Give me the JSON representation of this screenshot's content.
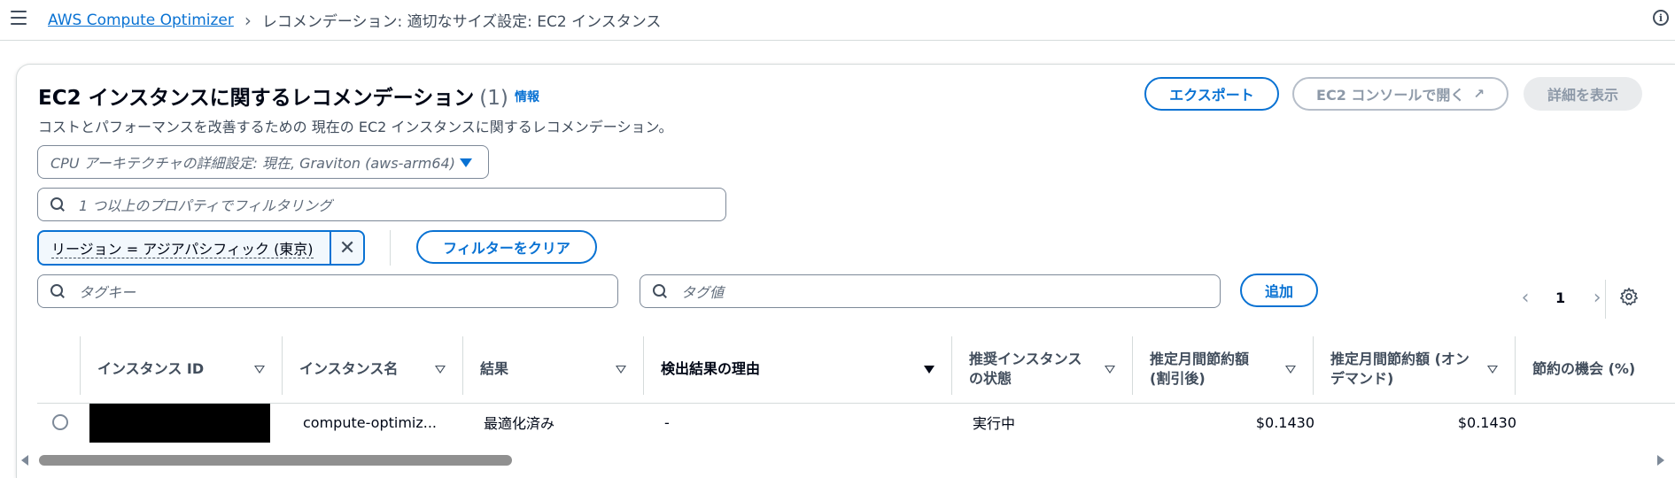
{
  "breadcrumb": {
    "root": "AWS Compute Optimizer",
    "current": "レコメンデーション: 適切なサイズ設定: EC2 インスタンス"
  },
  "header": {
    "title": "EC2 インスタンスに関するレコメンデーション",
    "count": "(1)",
    "info": "情報",
    "description": "コストとパフォーマンスを改善するための 現在の EC2 インスタンスに関するレコメンデーション。"
  },
  "actions": {
    "export": "エクスポート",
    "open_console": "EC2 コンソールで開く",
    "view_details": "詳細を表示"
  },
  "cpu_select": {
    "value": "CPU アーキテクチャの詳細設定: 現在, Graviton (aws-arm64)"
  },
  "filter": {
    "placeholder": "1 つ以上のプロパティでフィルタリング",
    "token": "リージョン = アジアパシフィック (東京)",
    "clear": "フィルターをクリア"
  },
  "tags": {
    "key_placeholder": "タグキー",
    "value_placeholder": "タグ値",
    "add": "追加"
  },
  "pagination": {
    "page": "1"
  },
  "table": {
    "columns": [
      "インスタンス ID",
      "インスタンス名",
      "結果",
      "検出結果の理由",
      "推奨インスタンスの状態",
      "推定月間節約額 (割引後)",
      "推定月間節約額 (オンデマンド)",
      "節約の機会 (%)"
    ],
    "rows": [
      {
        "instance_id": "",
        "instance_name": "compute-optimiz...",
        "finding": "最適化済み",
        "finding_reason": "-",
        "status": "実行中",
        "savings_discounted": "$0.1430",
        "savings_ondemand": "$0.1430"
      }
    ]
  }
}
